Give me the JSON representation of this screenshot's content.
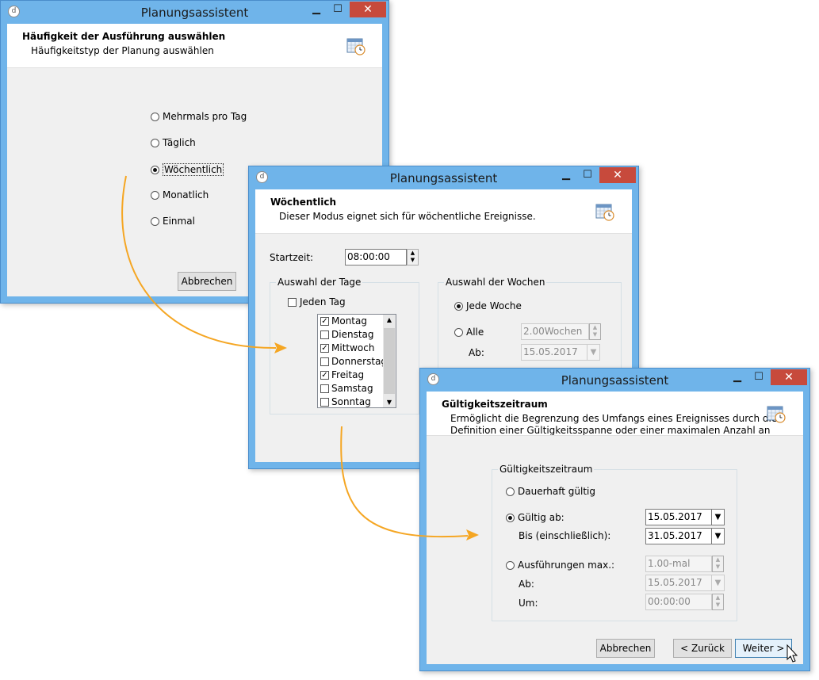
{
  "app_title": "Planungsassistent",
  "window_controls": {
    "minimize": "▁",
    "maximize": "☐",
    "close": "✕"
  },
  "dialog1": {
    "header_title": "Häufigkeit der Ausführung auswählen",
    "header_subtitle": "Häufigkeitstyp der Planung auswählen",
    "options": [
      "Mehrmals pro Tag",
      "Täglich",
      "Wöchentlich",
      "Monatlich",
      "Einmal"
    ],
    "selected": "Wöchentlich",
    "cancel_label": "Abbrechen"
  },
  "dialog2": {
    "header_title": "Wöchentlich",
    "header_subtitle": "Dieser Modus eignet sich für wöchentliche Ereignisse.",
    "start_label": "Startzeit:",
    "start_value": "08:00:00",
    "days_group": "Auswahl der Tage",
    "every_day": "Jeden Tag",
    "days": [
      {
        "label": "Montag",
        "checked": true
      },
      {
        "label": "Dienstag",
        "checked": false
      },
      {
        "label": "Mittwoch",
        "checked": true
      },
      {
        "label": "Donnerstag",
        "checked": false
      },
      {
        "label": "Freitag",
        "checked": true
      },
      {
        "label": "Samstag",
        "checked": false
      },
      {
        "label": "Sonntag",
        "checked": false
      }
    ],
    "weeks_group": "Auswahl der Wochen",
    "every_week": "Jede Woche",
    "every_n": "Alle",
    "every_n_value": "2.00Wochen",
    "from_label": "Ab:",
    "from_value": "15.05.2017"
  },
  "dialog3": {
    "header_title": "Gültigkeitszeitraum",
    "header_subtitle_line1": "Ermöglicht die Begrenzung des Umfangs eines Ereignisses durch die",
    "header_subtitle_line2": "Definition einer Gültigkeitsspanne oder einer maximalen Anzahl an",
    "group_label": "Gültigkeitszeitraum",
    "permanent": "Dauerhaft gültig",
    "valid_from": "Gültig ab:",
    "valid_from_value": "15.05.2017",
    "until_label": "Bis (einschließlich):",
    "until_value": "31.05.2017",
    "max_runs": "Ausführungen max.:",
    "max_runs_value": "1.00-mal",
    "from_label": "Ab:",
    "from_value": "15.05.2017",
    "at_label": "Um:",
    "at_value": "00:00:00",
    "cancel_label": "Abbrechen",
    "back_label": "< Zurück",
    "next_label": "Weiter >"
  },
  "colors": {
    "arrow": "#f5a623",
    "frame": "#6fb4ea",
    "close": "#c74a3c"
  }
}
